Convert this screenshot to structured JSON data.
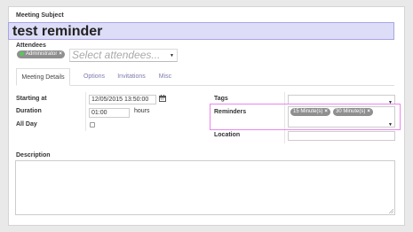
{
  "form": {
    "subject_label": "Meeting Subject",
    "subject_value": "test reminder",
    "attendees_label": "Attendees",
    "attendee_tags": [
      {
        "label": "Administrator",
        "status_color": "#59c65a"
      }
    ],
    "attendee_placeholder": "Select attendees...",
    "tabs": [
      {
        "label": "Meeting Details",
        "active": true
      },
      {
        "label": "Options",
        "active": false
      },
      {
        "label": "Invitations",
        "active": false
      },
      {
        "label": "Misc",
        "active": false
      }
    ],
    "starting_at_label": "Starting at",
    "starting_at_value": "12/05/2015 13:50:00",
    "duration_label": "Duration",
    "duration_value": "01:00",
    "duration_unit": "hours",
    "all_day_label": "All Day",
    "all_day_checked": false,
    "tags_label": "Tags",
    "reminders_label": "Reminders",
    "reminder_tags": [
      {
        "label": "15 Minute(s)"
      },
      {
        "label": "30 Minute(s)"
      }
    ],
    "location_label": "Location",
    "description_label": "Description"
  },
  "icons": {
    "calendar": "calendar-icon",
    "remove": "remove-tag-icon",
    "dropdown": "caret-down-icon",
    "resize": "resize-handle-icon"
  },
  "colors": {
    "subject_bg": "#ddddf8",
    "subject_border": "#a9a4e4",
    "tag_bg": "#8f8f8f",
    "tab_link": "#7c7bad",
    "highlight": "#ea86ee"
  }
}
